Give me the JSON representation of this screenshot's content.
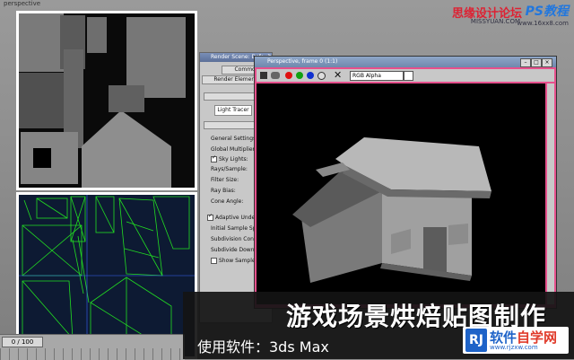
{
  "viewport_label": "perspective",
  "watermark": {
    "site_cn": "思缘设计论坛",
    "site_en": "MISSYUAN.COM",
    "brand": "PS教程",
    "url": "www.16xx8.com"
  },
  "render_dialog": {
    "title": "Render Scene: Default Scanline Renderer",
    "tabs": [
      "Common",
      "Render Elements"
    ],
    "plugin": "Light Tracer",
    "section_general": "General Settings",
    "global_multiplier": "Global Multiplier:",
    "sky_lights": "Sky Lights:",
    "rays_sample": "Rays/Sample:",
    "filter_size": "Filter Size:",
    "ray_bias": "Ray Bias:",
    "cone_angle": "Cone Angle:",
    "adaptive": "Adaptive Unde",
    "initial_sample": "Initial Sample Spa",
    "subdivision_contrast": "Subdivision Contr",
    "subdivide_down": "Subdivide Down",
    "show_samples": "Show Sample"
  },
  "frame_window": {
    "title": "Perspective, frame 0 (1:1)",
    "channel": "RGB Alpha"
  },
  "timeline": {
    "position": "0 / 100"
  },
  "caption": {
    "title": "游戏场景烘焙贴图制作",
    "subtitle": "使用软件：3ds Max"
  },
  "logo": {
    "mark": "RJ",
    "name_a": "软件",
    "name_b": "自学网",
    "url": "www.rjzxw.com"
  },
  "colors": {
    "frame_border": "#e6508c",
    "wire_green": "#22dd22",
    "panel_border": "#ffffff"
  }
}
